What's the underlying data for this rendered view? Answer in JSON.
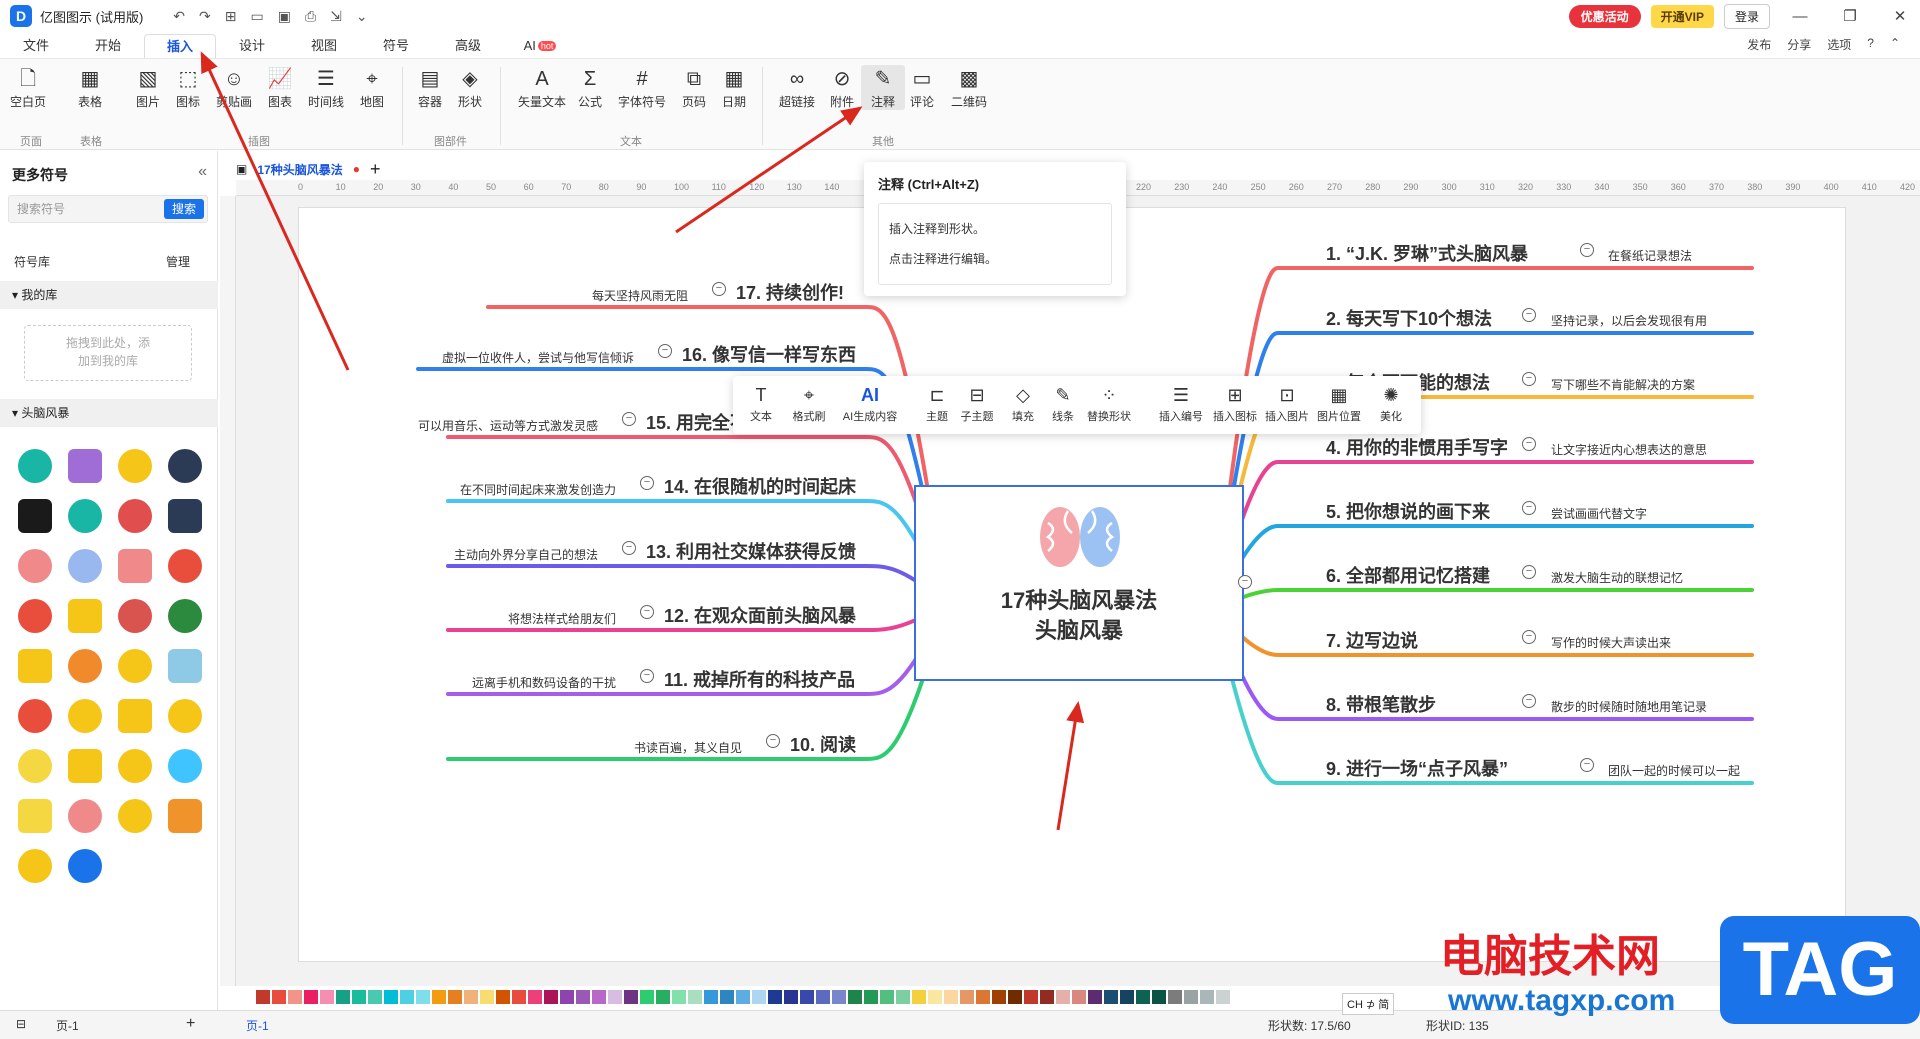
{
  "app": {
    "title": "亿图图示 (试用版)"
  },
  "titlebar": {
    "promo": "优惠活动",
    "vip": "开通VIP",
    "login": "登录"
  },
  "menu": {
    "tabs": [
      "文件",
      "开始",
      "插入",
      "设计",
      "视图",
      "符号",
      "高级",
      "AI"
    ],
    "active": "插入",
    "ai_badge": "hot",
    "right": [
      "发布",
      "分享",
      "选项"
    ]
  },
  "ribbon": {
    "buttons": {
      "blank_page": "空白页",
      "table": "表格",
      "image": "图片",
      "icon": "图标",
      "clipart": "剪贴画",
      "chart": "图表",
      "timeline": "时间线",
      "map": "地图",
      "container": "容器",
      "shape": "形状",
      "vector_text": "矢量文本",
      "formula": "公式",
      "font_symbol": "字体符号",
      "page_number": "页码",
      "date": "日期",
      "hyperlink": "超链接",
      "attachment": "附件",
      "note": "注释",
      "comment": "评论",
      "qrcode": "二维码"
    },
    "groups": {
      "page": "页面",
      "table": "表格",
      "illustration": "插图",
      "parts": "图部件",
      "text": "文本",
      "other": "其他"
    }
  },
  "tooltip": {
    "title": "注释 (Ctrl+Alt+Z)",
    "line1": "插入注释到形状。",
    "line2": "点击注释进行编辑。"
  },
  "leftpanel": {
    "header": "更多符号",
    "search_placeholder": "搜索符号",
    "search_btn": "搜索",
    "library_label": "符号库",
    "manage": "管理",
    "my_library": "我的库",
    "drop_hint_1": "拖拽到此处，添",
    "drop_hint_2": "加到我的库",
    "category": "头脑风暴"
  },
  "document": {
    "tab": "17种头脑风暴法"
  },
  "ruler": {
    "h_ticks": [
      "0",
      "10",
      "20",
      "30",
      "40",
      "50",
      "60",
      "70",
      "80",
      "90",
      "100",
      "110",
      "120",
      "130",
      "140",
      "220",
      "230",
      "240",
      "250",
      "260",
      "270",
      "280",
      "290",
      "300",
      "310",
      "320",
      "330",
      "340",
      "350",
      "360",
      "370",
      "380",
      "390",
      "400",
      "410",
      "420"
    ]
  },
  "mindmap": {
    "center_line1": "17种头脑风暴法",
    "center_line2": "头脑风暴",
    "right": [
      {
        "title": "1. “J.K. 罗琳”式头脑风暴",
        "note": "在餐纸记录想法",
        "color": "#f06464"
      },
      {
        "title": "2. 每天写下10个想法",
        "note": "坚持记录，以后会发现很有用",
        "color": "#2f80ed"
      },
      {
        "title": "3. 每个不可能的想法",
        "note": "写下哪些不肯能解决的方案",
        "color": "#f6b93b"
      },
      {
        "title": "4. 用你的非惯用手写字",
        "note": "让文字接近内心想表达的意思",
        "color": "#e84393"
      },
      {
        "title": "5. 把你想说的画下来",
        "note": "尝试画画代替文字",
        "color": "#22a6e0"
      },
      {
        "title": "6. 全部都用记忆搭建",
        "note": "激发大脑生动的联想记忆",
        "color": "#4cd137"
      },
      {
        "title": "7. 边写边说",
        "note": "写作的时候大声读出来",
        "color": "#f0932b"
      },
      {
        "title": "8. 带根笔散步",
        "note": "散步的时候随时随地用笔记录",
        "color": "#9b59f6"
      },
      {
        "title": "9. 进行一场“点子风暴”",
        "note": "团队一起的时候可以一起",
        "color": "#48d1cc"
      }
    ],
    "left": [
      {
        "title": "17. 持续创作!",
        "note": "每天坚持风雨无阻",
        "color": "#f06464"
      },
      {
        "title": "16. 像写信一样写东西",
        "note": "虚拟一位收件人，尝试与他写信倾诉",
        "color": "#2f80ed"
      },
      {
        "title": "15. 用完全不同的方式创造",
        "note": "可以用音乐、运动等方式激发灵感",
        "color": "#ee5a6f"
      },
      {
        "title": "14. 在很随机的时间起床",
        "note": "在不同时间起床来激发创造力",
        "color": "#48c6ef"
      },
      {
        "title": "13. 利用社交媒体获得反馈",
        "note": "主动向外界分享自己的想法",
        "color": "#6c5ce7"
      },
      {
        "title": "12. 在观众面前头脑风暴",
        "note": "将想法样式给朋友们",
        "color": "#e84393"
      },
      {
        "title": "11. 戒掉所有的科技产品",
        "note": "远离手机和数码设备的干扰",
        "color": "#a55eea"
      },
      {
        "title": "10. 阅读",
        "note": "书读百遍，其义自见",
        "color": "#2ecc71"
      }
    ]
  },
  "floatbar": {
    "buttons": [
      "文本",
      "格式刷",
      "AI生成内容",
      "主题",
      "子主题",
      "填充",
      "线条",
      "替换形状",
      "插入编号",
      "插入图标",
      "插入图片",
      "图片位置",
      "美化"
    ]
  },
  "status": {
    "page_tab": "页-1",
    "page_label": "页-1",
    "shape_count": "形状数: 17.5/60",
    "ime": "CH ⊅ 简",
    "shape_id": "形状ID: 135"
  },
  "watermark": {
    "text": "电脑技术网",
    "url": "www.tagxp.com",
    "tag": "TAG"
  },
  "symbol_colors": [
    "#19b5a5",
    "#a06cd5",
    "#f5c518",
    "#2b3a55",
    "#1a1a1a",
    "#19b5a5",
    "#e04e4e",
    "#2b3a55",
    "#f08a8a",
    "#9ab8f0",
    "#f08a8a",
    "#e94e3c",
    "#e94e3c",
    "#f5c518",
    "#d9534f",
    "#2b8a3e",
    "#f5c518",
    "#f08a2b",
    "#f5c518",
    "#8ecae6",
    "#e94e3c",
    "#f5c518",
    "#f5c518",
    "#f5c518",
    "#f5d742",
    "#f5c518",
    "#f5c518",
    "#40c4ff",
    "#f5d742",
    "#f08a8a",
    "#f5c518",
    "#f0932b",
    "#f5c518",
    "#1a73e8"
  ],
  "palette_colors": [
    "#c0392b",
    "#e74c3c",
    "#f1948a",
    "#e91e63",
    "#f48fb1",
    "#16a085",
    "#1abc9c",
    "#48c9b0",
    "#00bcd4",
    "#4dd0e1",
    "#80deea",
    "#f39c12",
    "#e67e22",
    "#f0b27a",
    "#f7dc6f",
    "#d35400",
    "#e74c3c",
    "#ec407a",
    "#ad1457",
    "#8e44ad",
    "#9b59b6",
    "#ba68c8",
    "#d7bde2",
    "#6c3483",
    "#2ecc71",
    "#27ae60",
    "#82e0aa",
    "#a9dfbf",
    "#3498db",
    "#2e86c1",
    "#5dade2",
    "#aed6f1",
    "#1f3a93",
    "#283593",
    "#3949ab",
    "#5c6bc0",
    "#7986cb",
    "#1e8449",
    "#229954",
    "#52be80",
    "#7dcea0",
    "#f4d03f",
    "#f9e79f",
    "#fad7a0",
    "#e59866",
    "#dc7633",
    "#a04000",
    "#6e2c00",
    "#c0392b",
    "#922b21",
    "#e6b0aa",
    "#d98880",
    "#5b2c6f",
    "#1b4f72",
    "#154360",
    "#0e6251",
    "#0b5345",
    "#7b7d7d",
    "#99a3a4",
    "#aab7b8",
    "#ccd1d1"
  ]
}
